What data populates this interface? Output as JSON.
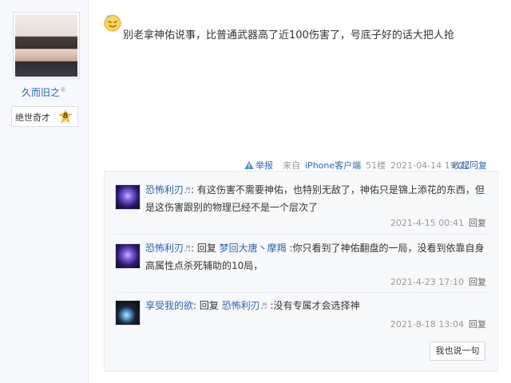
{
  "user": {
    "name": "久而旧之",
    "name_mark": "®",
    "level_name": "绝世奇才",
    "level": "8"
  },
  "post": {
    "icon": "sweat-smile-emoji",
    "text": "别老拿神佑说事，比普通武器高了近100伤害了，号底子好的话大把人抢"
  },
  "meta": {
    "report": "举报",
    "source_prefix": "来自",
    "source_device": "iPhone客户端",
    "floor": "51楼",
    "time": "2021-04-14 19:22",
    "collapse": "收起回复"
  },
  "replies": [
    {
      "name": "恐怖利刃",
      "name_tail": "♬",
      "reply_to_label": "",
      "reply_to": "",
      "reply_to_tail": "",
      "text_line1": ": 有这伤害不需要神佑，也特别无敌了，神佑只是锦上添花的东西，但",
      "text_line2": "是这伤害跟别的物理已经不是一个层次了",
      "time": "2021-4-15 00:41",
      "reply_btn": "回复"
    },
    {
      "name": "恐怖利刃",
      "name_tail": "♬",
      "reply_to_label": ": 回复 ",
      "reply_to": "梦回大唐丶摩羯",
      "reply_to_tail": "",
      "text_line1": " :你只看到了神佑翻盘的一局，没看到依靠自身",
      "text_line2": "高属性点杀死辅助的10局，",
      "time": "2021-4-23 17:10",
      "reply_btn": "回复"
    },
    {
      "name": "享受我的欲",
      "name_tail": "",
      "reply_to_label": ": 回复 ",
      "reply_to": "恐怖利刃",
      "reply_to_tail": "♬",
      "text_line1": " :没有专属才会选择神",
      "text_line2": "",
      "time": "2021-8-18 13:04",
      "reply_btn": "回复"
    }
  ],
  "say_button": "我也说一句",
  "colors": {
    "link": "#2d64b3",
    "muted": "#999999",
    "panel_bg": "#f7f8fa"
  }
}
